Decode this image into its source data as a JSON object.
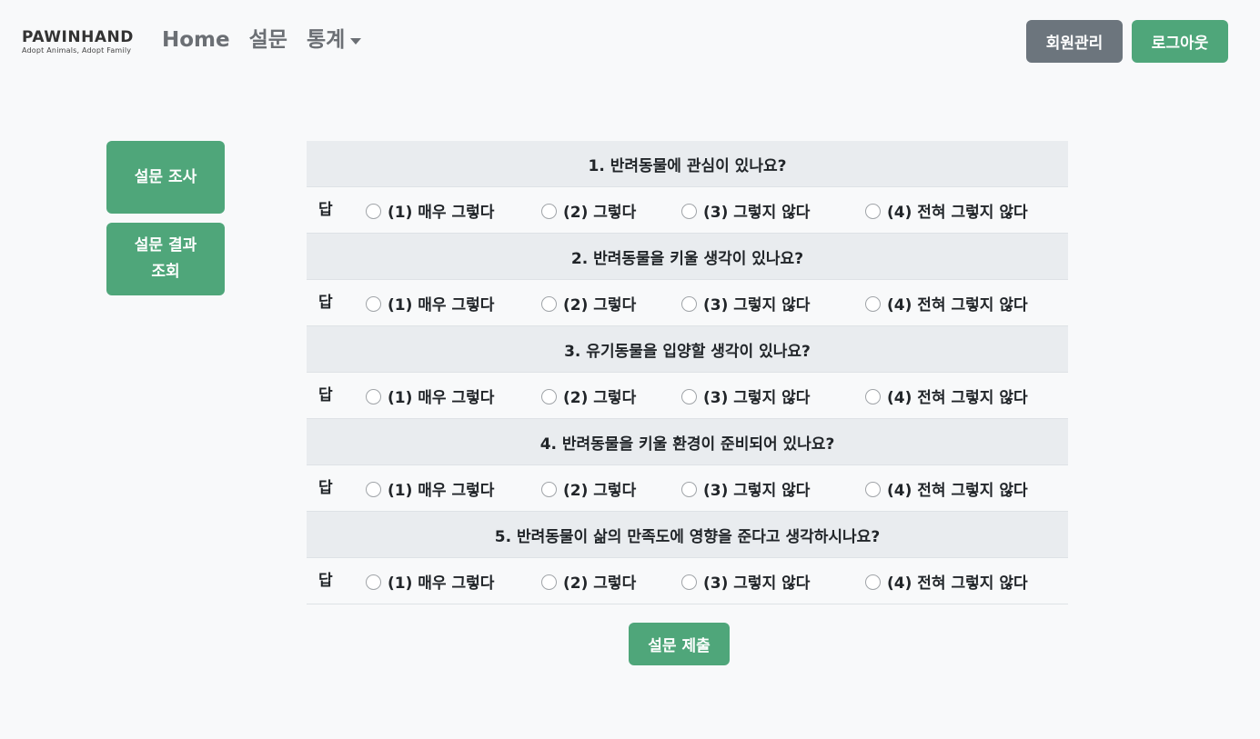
{
  "brand": {
    "name": "PAWINHAND",
    "tagline": "Adopt Animals, Adopt Family"
  },
  "nav": {
    "home": "Home",
    "survey": "설문",
    "stats": "통계"
  },
  "header_buttons": {
    "members": "회원관리",
    "logout": "로그아웃"
  },
  "sidebar": {
    "survey": "설문 조사",
    "results_line1": "설문 결과",
    "results_line2": "조회"
  },
  "answer_label": "답",
  "options": [
    "(1) 매우 그렇다",
    "(2) 그렇다",
    "(3) 그렇지 않다",
    "(4) 전혀 그렇지 않다"
  ],
  "questions": [
    "1. 반려동물에 관심이 있나요?",
    "2. 반려동물을 키울 생각이 있나요?",
    "3. 유기동물을 입양할 생각이 있나요?",
    "4. 반려동물을 키울 환경이 준비되어 있나요?",
    "5. 반려동물이 삶의 만족도에 영향을 준다고 생각하시나요?"
  ],
  "submit": "설문 제출",
  "colors": {
    "accent": "#4fa67a",
    "secondary": "#6c757d"
  }
}
